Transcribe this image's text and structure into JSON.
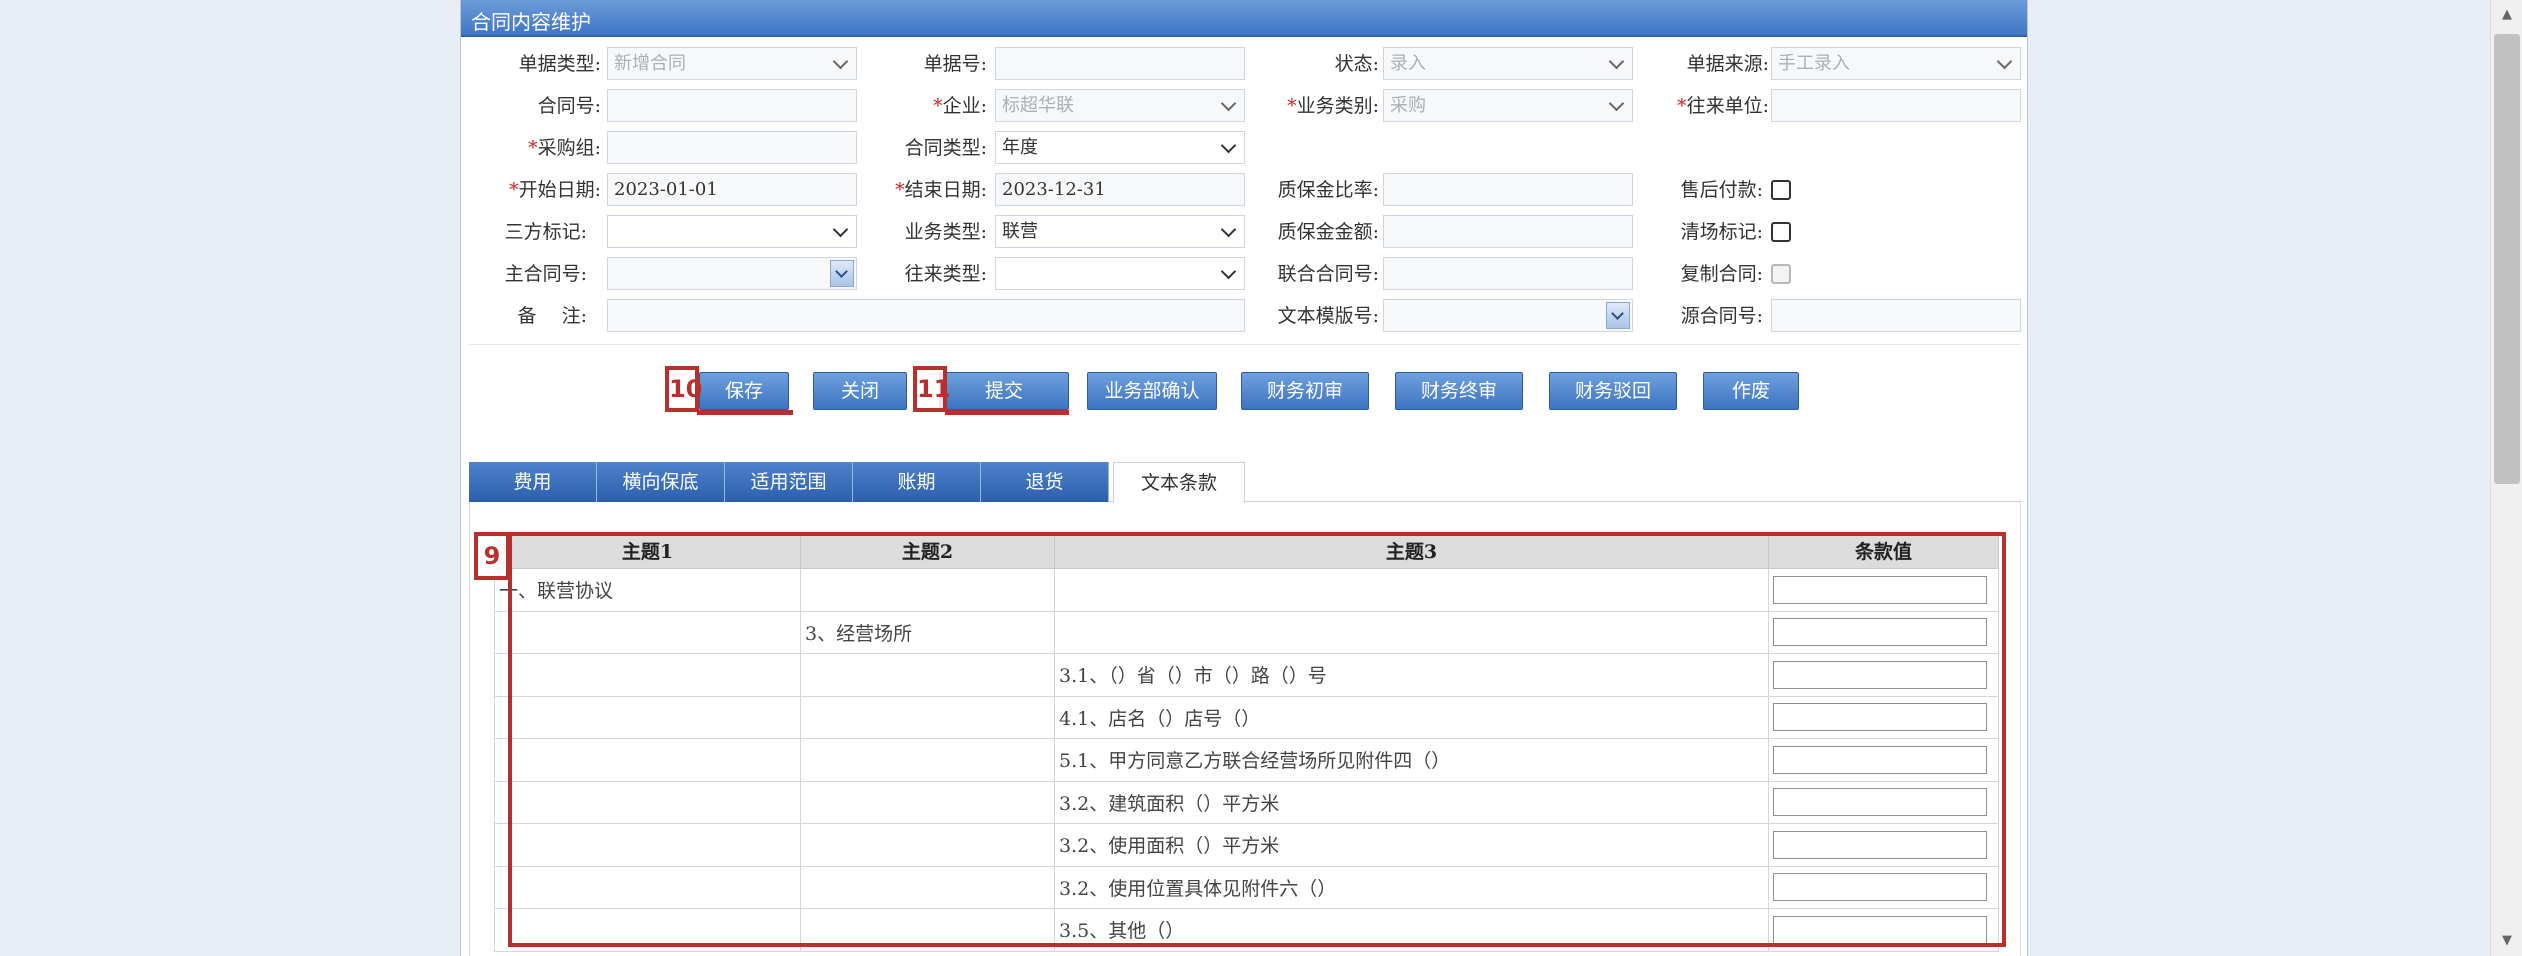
{
  "panel": {
    "title": "合同内容维护"
  },
  "form": {
    "doc_type": {
      "label": "单据类型:",
      "value": "新增合同"
    },
    "doc_no": {
      "label": "单据号:",
      "value": ""
    },
    "status": {
      "label": "状态:",
      "value": "录入"
    },
    "doc_source": {
      "label": "单据来源:",
      "value": "手工录入"
    },
    "contract_no": {
      "label": "合同号:",
      "value": ""
    },
    "enterprise": {
      "label": "企业:",
      "value": "标超华联"
    },
    "biz_category": {
      "label": "业务类别:",
      "value": "采购"
    },
    "partner": {
      "label": "往来单位:",
      "value": ""
    },
    "purchase_group": {
      "label": "采购组:",
      "value": ""
    },
    "contract_type": {
      "label": "合同类型:",
      "value": "年度"
    },
    "start_date": {
      "label": "开始日期:",
      "value": "2023-01-01"
    },
    "end_date": {
      "label": "结束日期:",
      "value": "2023-12-31"
    },
    "deposit_rate": {
      "label": "质保金比率:",
      "value": ""
    },
    "after_sale_pay": {
      "label": "售后付款:"
    },
    "tripartite": {
      "label": "三方标记:",
      "value": ""
    },
    "biz_type": {
      "label": "业务类型:",
      "value": "联营"
    },
    "deposit_amount": {
      "label": "质保金金额:",
      "value": ""
    },
    "clearance": {
      "label": "清场标记:"
    },
    "master_contract": {
      "label": "主合同号:",
      "value": ""
    },
    "partner_type": {
      "label": "往来类型:",
      "value": ""
    },
    "joint_contract": {
      "label": "联合合同号:",
      "value": ""
    },
    "copy_contract": {
      "label": "复制合同:"
    },
    "remark": {
      "label": "备　 注:",
      "value": ""
    },
    "template_no": {
      "label": "文本模版号:",
      "value": ""
    },
    "source_contract": {
      "label": "源合同号:",
      "value": ""
    }
  },
  "buttons": {
    "save": "保存",
    "close": "关闭",
    "submit": "提交",
    "biz_confirm": "业务部确认",
    "fin_first": "财务初审",
    "fin_final": "财务终审",
    "fin_reject": "财务驳回",
    "void": "作废"
  },
  "markers": {
    "save": "10",
    "submit": "11",
    "grid": "9"
  },
  "tabs": [
    "费用",
    "横向保底",
    "适用范围",
    "账期",
    "退货",
    "文本条款"
  ],
  "grid": {
    "headers": [
      "主题1",
      "主题2",
      "主题3",
      "条款值"
    ],
    "rows": [
      [
        "一、联营协议",
        "",
        ""
      ],
      [
        "",
        "3、经营场所",
        ""
      ],
      [
        "",
        "",
        "3.1、（）省（）市（）路（）号"
      ],
      [
        "",
        "",
        "4.1、店名（）店号（）"
      ],
      [
        "",
        "",
        "5.1、甲方同意乙方联合经营场所见附件四（）"
      ],
      [
        "",
        "",
        "3.2、建筑面积（）平方米"
      ],
      [
        "",
        "",
        "3.2、使用面积（）平方米"
      ],
      [
        "",
        "",
        "3.2、使用位置具体见附件六（）"
      ],
      [
        "",
        "",
        "3.5、其他（）"
      ]
    ]
  },
  "icons": {
    "scroll_up": "▲",
    "scroll_down": "▼"
  }
}
